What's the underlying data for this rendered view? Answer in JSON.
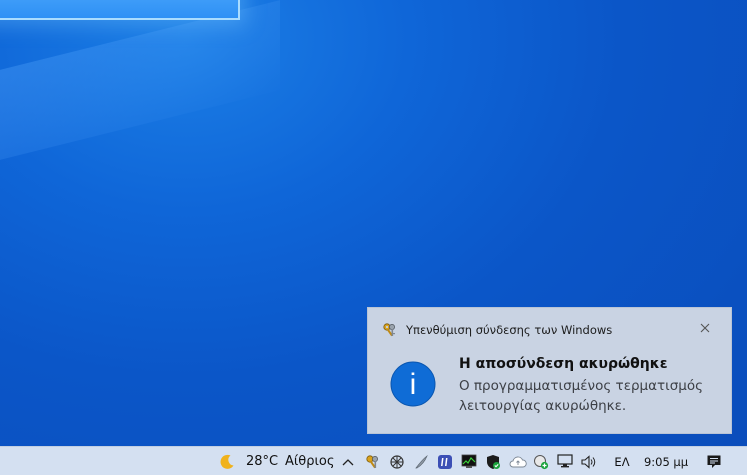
{
  "notification": {
    "app_name": "Υπενθύμιση σύνδεσης των Windows",
    "title": "Η αποσύνδεση ακυρώθηκε",
    "body": "Ο προγραμματισμένος τερματισμός λειτουργίας ακυρώθηκε.",
    "info_glyph": "i",
    "close_glyph": "✕"
  },
  "taskbar": {
    "weather": {
      "temperature": "28°C",
      "condition": "Αίθριος",
      "icon": "moon-icon"
    },
    "tray_icons": [
      "chevron-up-icon",
      "keys-icon",
      "network-grid-icon",
      "feather-icon",
      "quote-app-icon",
      "monitor-chart-icon",
      "shield-check-icon",
      "cloud-upload-icon",
      "sync-badge-icon",
      "network-icon",
      "volume-icon"
    ],
    "language": "ΕΛ",
    "clock": "9:05 μμ",
    "action_center_icon": "notification-icon"
  },
  "colors": {
    "desktop_blue": "#0b56c8",
    "toast_bg": "#c9d3e3",
    "info_blue": "#0f6cd6",
    "taskbar_bg": "#d4e0f1"
  }
}
